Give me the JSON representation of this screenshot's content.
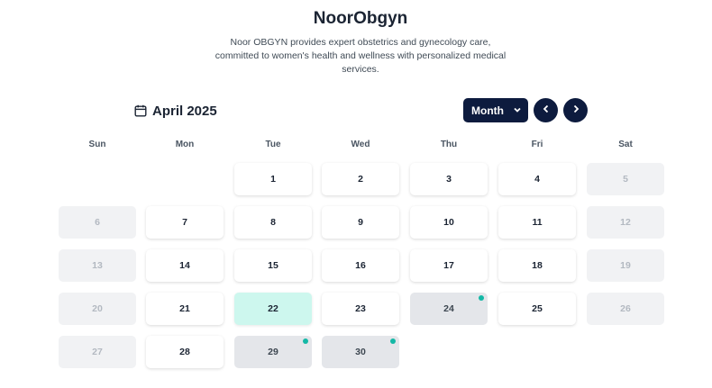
{
  "header": {
    "title": "NoorObgyn",
    "description": "Noor OBGYN provides expert obstetrics and gynecology care, committed to women's health and wellness with personalized medical services."
  },
  "calendar": {
    "month_label": "April 2025",
    "calendar_icon": "calendar-icon",
    "view_select": {
      "selected": "Month",
      "icon": "chevron-down-icon"
    },
    "nav": {
      "prev_icon": "chevron-left-icon",
      "next_icon": "chevron-right-icon"
    },
    "weekdays": [
      "Sun",
      "Mon",
      "Tue",
      "Wed",
      "Thu",
      "Fri",
      "Sat"
    ],
    "first_weekday_index": 2,
    "days": [
      {
        "label": "1",
        "state": "normal"
      },
      {
        "label": "2",
        "state": "normal"
      },
      {
        "label": "3",
        "state": "normal"
      },
      {
        "label": "4",
        "state": "normal"
      },
      {
        "label": "5",
        "state": "weekend"
      },
      {
        "label": "6",
        "state": "weekend"
      },
      {
        "label": "7",
        "state": "normal"
      },
      {
        "label": "8",
        "state": "normal"
      },
      {
        "label": "9",
        "state": "normal"
      },
      {
        "label": "10",
        "state": "normal"
      },
      {
        "label": "11",
        "state": "normal"
      },
      {
        "label": "12",
        "state": "weekend"
      },
      {
        "label": "13",
        "state": "weekend"
      },
      {
        "label": "14",
        "state": "normal"
      },
      {
        "label": "15",
        "state": "normal"
      },
      {
        "label": "16",
        "state": "normal"
      },
      {
        "label": "17",
        "state": "normal"
      },
      {
        "label": "18",
        "state": "normal"
      },
      {
        "label": "19",
        "state": "weekend"
      },
      {
        "label": "20",
        "state": "weekend"
      },
      {
        "label": "21",
        "state": "normal"
      },
      {
        "label": "22",
        "state": "today"
      },
      {
        "label": "23",
        "state": "normal"
      },
      {
        "label": "24",
        "state": "booked",
        "dot": true
      },
      {
        "label": "25",
        "state": "normal"
      },
      {
        "label": "26",
        "state": "weekend"
      },
      {
        "label": "27",
        "state": "weekend"
      },
      {
        "label": "28",
        "state": "normal"
      },
      {
        "label": "29",
        "state": "booked",
        "dot": true
      },
      {
        "label": "30",
        "state": "booked",
        "dot": true
      }
    ]
  },
  "colors": {
    "primary": "#0d1b3e",
    "today": "#cdf7ee",
    "booked": "#e4e6ea",
    "weekend": "#f1f2f4",
    "indicator": "#14b8a6"
  }
}
